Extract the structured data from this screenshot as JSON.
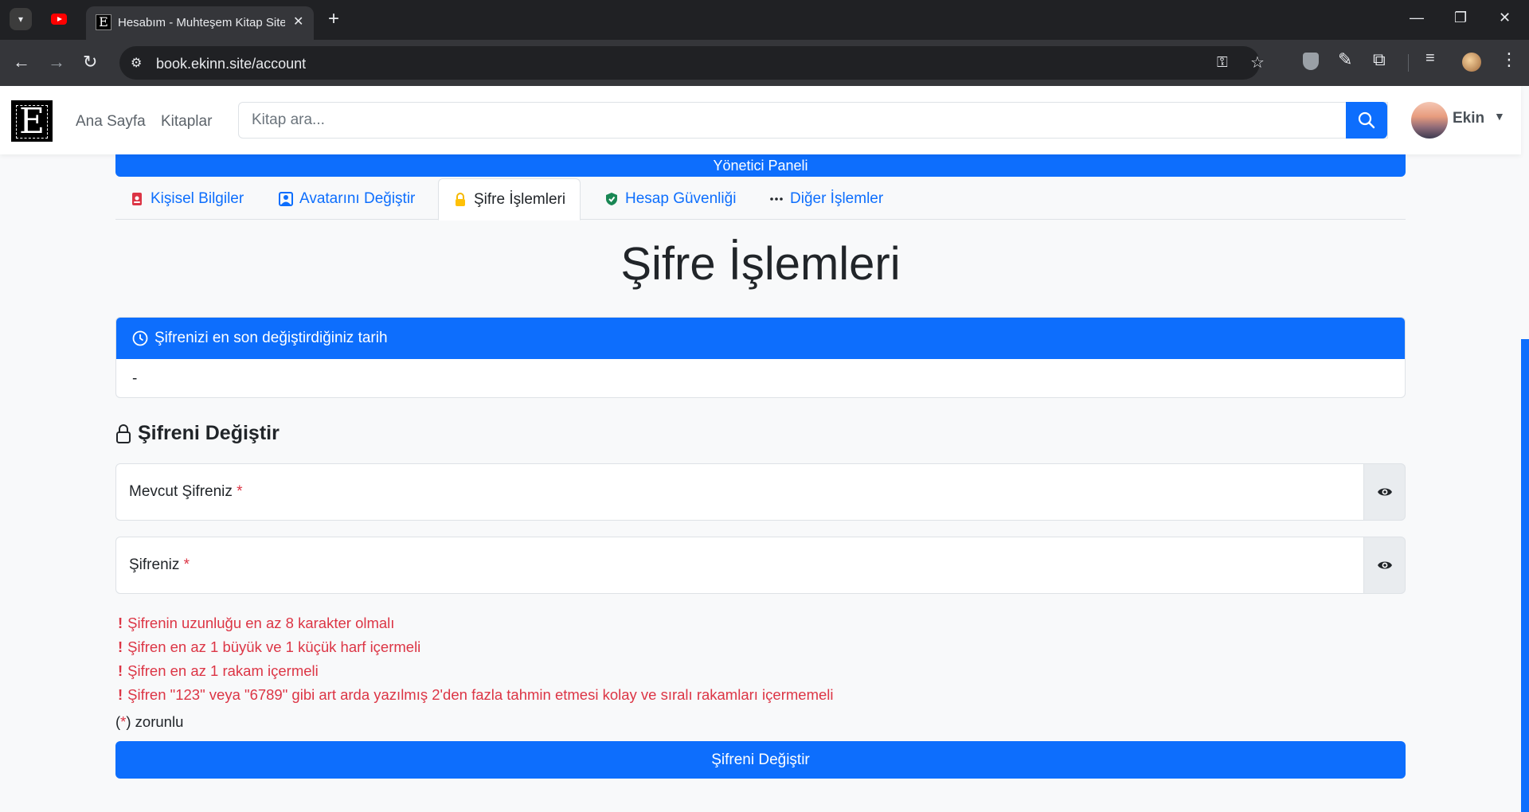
{
  "browser": {
    "tab_title": "Hesabım - Muhteşem Kitap Sitesi",
    "url": "book.ekinn.site/account"
  },
  "site": {
    "logo_letter": "E",
    "nav_home": "Ana Sayfa",
    "nav_books": "Kitaplar",
    "search_placeholder": "Kitap ara...",
    "user_name": "Ekin",
    "admin_button": "Yönetici Paneli"
  },
  "tabs": [
    {
      "label": "Kişisel Bilgiler",
      "icon": "person-badge-icon",
      "active": false
    },
    {
      "label": "Avatarını Değiştir",
      "icon": "person-square-icon",
      "active": false
    },
    {
      "label": "Şifre İşlemleri",
      "icon": "lock-icon",
      "active": true
    },
    {
      "label": "Hesap Güvenliği",
      "icon": "shield-check-icon",
      "active": false
    },
    {
      "label": "Diğer İşlemler",
      "icon": "three-dots-icon",
      "active": false
    }
  ],
  "page_title": "Şifre İşlemleri",
  "last_changed": {
    "header": "Şifrenizi en son değiştirdiğiniz tarih",
    "value": "-"
  },
  "change_section": {
    "title": "Şifreni Değiştir",
    "current_label": "Mevcut Şifreniz",
    "new_label": "Şifreniz",
    "required_mark": "*"
  },
  "rules": [
    "Şifrenin uzunluğu en az 8 karakter olmalı",
    "Şifren en az 1 büyük ve 1 küçük harf içermeli",
    "Şifren en az 1 rakam içermeli",
    "Şifren \"123\" veya \"6789\" gibi art arda yazılmış 2'den fazla tahmin etmesi kolay ve sıralı rakamları içermemeli"
  ],
  "rule_bullet": "!",
  "required_note": {
    "open": "(",
    "star": "*",
    "close": ") zorunlu"
  },
  "submit_label": "Şifreni Değiştir",
  "colors": {
    "primary": "#0d6efd",
    "danger": "#dc3545",
    "chrome_bg": "#202124"
  }
}
